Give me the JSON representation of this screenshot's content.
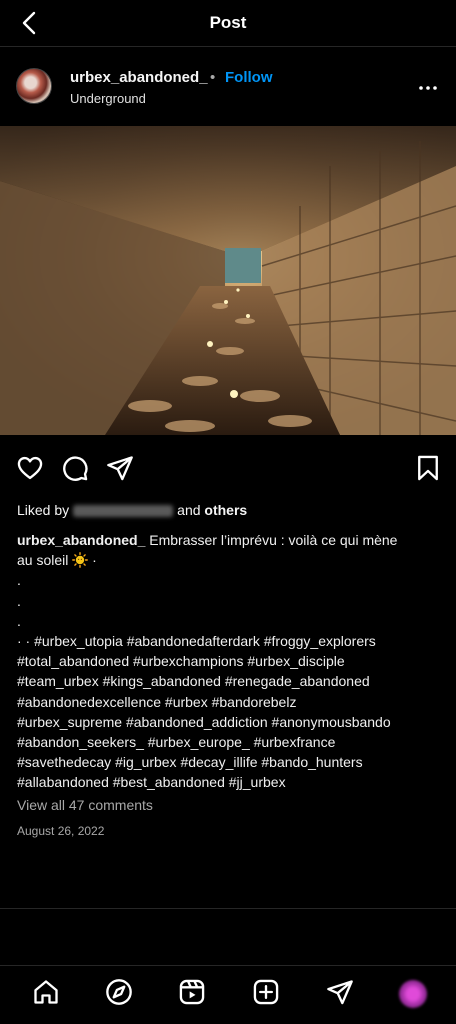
{
  "topbar": {
    "title": "Post"
  },
  "post": {
    "username": "urbex_abandoned_",
    "separator": "•",
    "follow_label": "Follow",
    "location": "Underground",
    "liked_by_prefix": "Liked by",
    "liked_by_connector": "and",
    "liked_by_others": "others",
    "caption": {
      "username": "urbex_abandoned_",
      "text": "Embrasser l’imprévu : voilà ce qui mène",
      "text_cont": "au soleil",
      "text_end": "·",
      "dot_lines": [
        ".",
        ".",
        "."
      ],
      "hashtag_lines": [
        "· · #urbex_utopia #abandonedafterdark #froggy_explorers",
        "#total_abandoned #urbexchampions #urbex_disciple",
        "#team_urbex #kings_abandoned #renegade_abandoned",
        "#abandonedexcellence #urbex #bandorebelz",
        "#urbex_supreme #abandoned_addiction #anonymousbando",
        "#abandon_seekers_ #urbex_europe_ #urbexfrance",
        "#savethedecay #ig_urbex #decay_illife #bando_hunters",
        "#allabandoned #best_abandoned #jj_urbex"
      ]
    },
    "view_comments": "View all 47 comments",
    "date": "August 26, 2022"
  },
  "icons": {
    "back": "chevron-left-icon",
    "more": "more-horizontal-icon",
    "like": "heart-icon",
    "comment": "comment-icon",
    "share": "send-icon",
    "save": "bookmark-icon",
    "sun": "sun-emoji-icon"
  },
  "colors": {
    "background": "#000000",
    "follow": "#0095f6",
    "muted": "#a8a8a8"
  }
}
